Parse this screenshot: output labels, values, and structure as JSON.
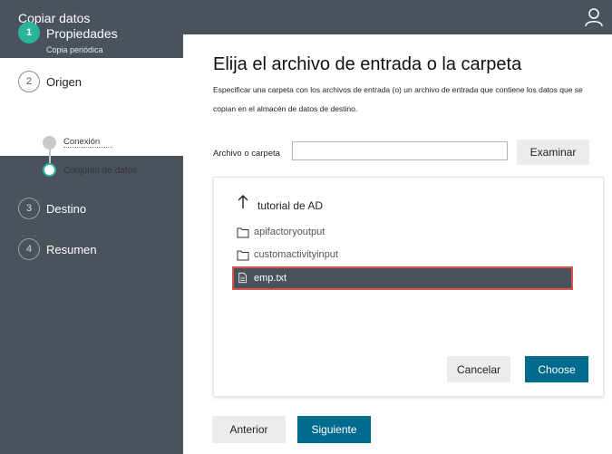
{
  "app": {
    "title": "Copiar datos",
    "user_icon": "user-icon"
  },
  "steps": [
    {
      "number": "1",
      "label": "Propiedades",
      "sublabel": "Copia periódica",
      "state": "completed"
    },
    {
      "number": "2",
      "label": "Origen",
      "state": "active",
      "substeps": [
        {
          "label": "Conexión",
          "state": "done"
        },
        {
          "label": "Conjunto de datos",
          "state": "current"
        }
      ]
    },
    {
      "number": "3",
      "label": "Destino",
      "state": "pending"
    },
    {
      "number": "4",
      "label": "Resumen",
      "state": "pending"
    }
  ],
  "main": {
    "title": "Elija el archivo de entrada o la carpeta",
    "description": "Especificar una carpeta con los archivos de entrada (o) un archivo de entrada que contiene los datos que se copian en el almacén de datos de destino.",
    "field_label": "Archivo o carpeta",
    "field_value": "",
    "browse_label": "Examinar"
  },
  "browser": {
    "current_path": "tutorial de AD",
    "items": [
      {
        "name": "apifactoryoutput",
        "type": "folder",
        "selected": false
      },
      {
        "name": "customactivityinput",
        "type": "folder",
        "selected": false
      },
      {
        "name": "emp.txt",
        "type": "file",
        "selected": true
      }
    ],
    "cancel_label": "Cancelar",
    "choose_label": "Choose"
  },
  "nav": {
    "prev_label": "Anterior",
    "next_label": "Siguiente"
  },
  "colors": {
    "sidebar": "#4a525c",
    "accent": "#2bb39b",
    "primary_button": "#006b8f",
    "selection_outline": "#d9534f"
  }
}
